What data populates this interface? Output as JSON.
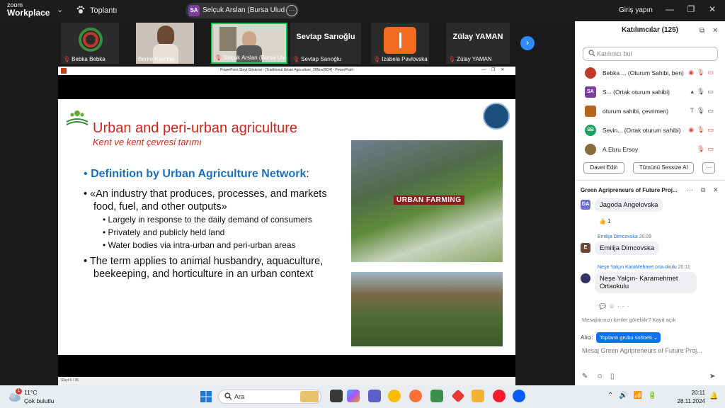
{
  "topbar": {
    "logo_top": "zoom",
    "logo_bottom": "Workplace",
    "meeting_label": "Toplantı",
    "share_avatar": "SA",
    "share_name": "Selçuk Arslan (Bursa Uludağ Üniv",
    "signin": "Giriş yapın"
  },
  "gallery": [
    {
      "name": "Bebka Bebka",
      "big": ""
    },
    {
      "name": "Berire Karataş",
      "big": ""
    },
    {
      "name": "Selçuk Arslan (Bursa Ulud...",
      "big": ""
    },
    {
      "name": "Sevtap Sarıoğlu",
      "big": "Sevtap Sarıoğlu"
    },
    {
      "name": "Izabela Pavlovska",
      "big": ""
    },
    {
      "name": "Zülay YAMAN",
      "big": "Zülay YAMAN"
    }
  ],
  "ppt": {
    "title": "PowerPoint Slayt Gösterisi - [Traditional Urban Agriculture_28Nov2024] - PowerPoint",
    "status": "Slayt 6 / 36"
  },
  "slide": {
    "title": "Urban and peri-urban agriculture",
    "subtitle": "Kent ve kent çevresi tarımı",
    "definition_bullet": "•",
    "definition_label": "Definition by Urban Agriculture Network",
    "definition_colon": ":",
    "bullet1_line1": "• «An industry that produces, processes, and markets",
    "bullet1_line2": "food, fuel, and other outputs»",
    "sub1": "• Largely in response to the daily demand of consumers",
    "sub2": "• Privately and publicly held land",
    "sub3": "• Water bodies via intra-urban and peri-urban areas",
    "bullet2_line1": "• The term applies to animal husbandry, aquaculture,",
    "bullet2_line2": "beekeeping, and horticulture in an urban context",
    "image_label": "URBAN FARMING"
  },
  "participants": {
    "header": "Katılımcılar (125)",
    "search_placeholder": "Katılımcı bul",
    "rows": [
      {
        "avatar": "",
        "name": "Bebka ...  (Oturum Sahibi, ben)",
        "color": "#c0392b"
      },
      {
        "avatar": "SA",
        "name": "S...  (Ortak oturum sahibi)",
        "color": "#7b3fa0"
      },
      {
        "avatar": "",
        "name": "oturum sahibi, çevrimen)",
        "color": "#b5651d"
      },
      {
        "avatar": "SB",
        "name": "Sevin...  (Ortak oturum sahibi)",
        "color": "#1aa15a"
      },
      {
        "avatar": "",
        "name": "A.Ebru Ersoy",
        "color": "#8a6d3b"
      }
    ],
    "invite_button": "Davet Edin",
    "mute_all_button": "Tümünü Sessize Al",
    "more_button": "···"
  },
  "chat": {
    "title": "Green Agripreneurs of Future Proj...",
    "messages": [
      {
        "avatar": "GA",
        "avatar_color": "#6d6fd1",
        "sender": "",
        "time": "",
        "text": "Jagoda Angelovska",
        "reaction": "👍 1"
      },
      {
        "avatar": "E",
        "avatar_color": "#6b4a3a",
        "sender": "Emilija Dimcovska",
        "time": "20:09",
        "text": "Emilija Dimcovska",
        "reaction": ""
      },
      {
        "avatar": "",
        "avatar_color": "#333366",
        "sender": "Neşe Yalçın KaraMehmet orta okulu",
        "time": "20:11",
        "text": "Neşe Yalçın- Karamehmet Ortaokulu",
        "reaction": ""
      }
    ],
    "privacy": "Mesajlarınızı kimler görebilir? Kayıt açık",
    "to_label": "Alıcı:",
    "to_value": "Toplantı grubu sohbeti ⌄",
    "input_placeholder": "Mesaj Green Agripreneurs of Future Proj..."
  },
  "taskbar": {
    "weather_badge": "1",
    "temperature": "11°C",
    "weather_desc": "Çok bulutlu",
    "search_text": "Ara",
    "time": "20:11",
    "date": "28.11.2024"
  }
}
